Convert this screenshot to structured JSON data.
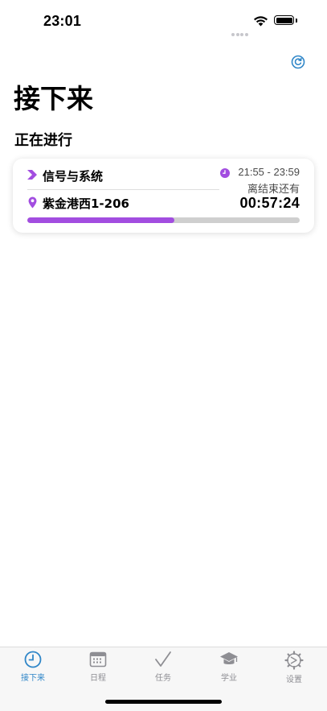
{
  "status_bar": {
    "time": "23:01"
  },
  "header": {
    "title": "接下来",
    "refresh_icon": "refresh-icon"
  },
  "section": {
    "title": "正在进行"
  },
  "current_class": {
    "course_name": "信号与系统",
    "location": "紫金港西1-206",
    "time_range": "21:55 - 23:59",
    "remain_label": "离结束还有",
    "countdown": "00:57:24",
    "progress_fraction": 0.54
  },
  "tabs": [
    {
      "label": "接下来",
      "icon": "clock-icon",
      "active": true
    },
    {
      "label": "日程",
      "icon": "calendar-icon",
      "active": false
    },
    {
      "label": "任务",
      "icon": "checkmark-icon",
      "active": false
    },
    {
      "label": "学业",
      "icon": "graduation-cap-icon",
      "active": false
    },
    {
      "label": "设置",
      "icon": "gear-icon",
      "active": false
    }
  ],
  "colors": {
    "accent": "#a24de0",
    "tab_active": "#2f86c8",
    "tab_inactive": "#8e8e93"
  }
}
